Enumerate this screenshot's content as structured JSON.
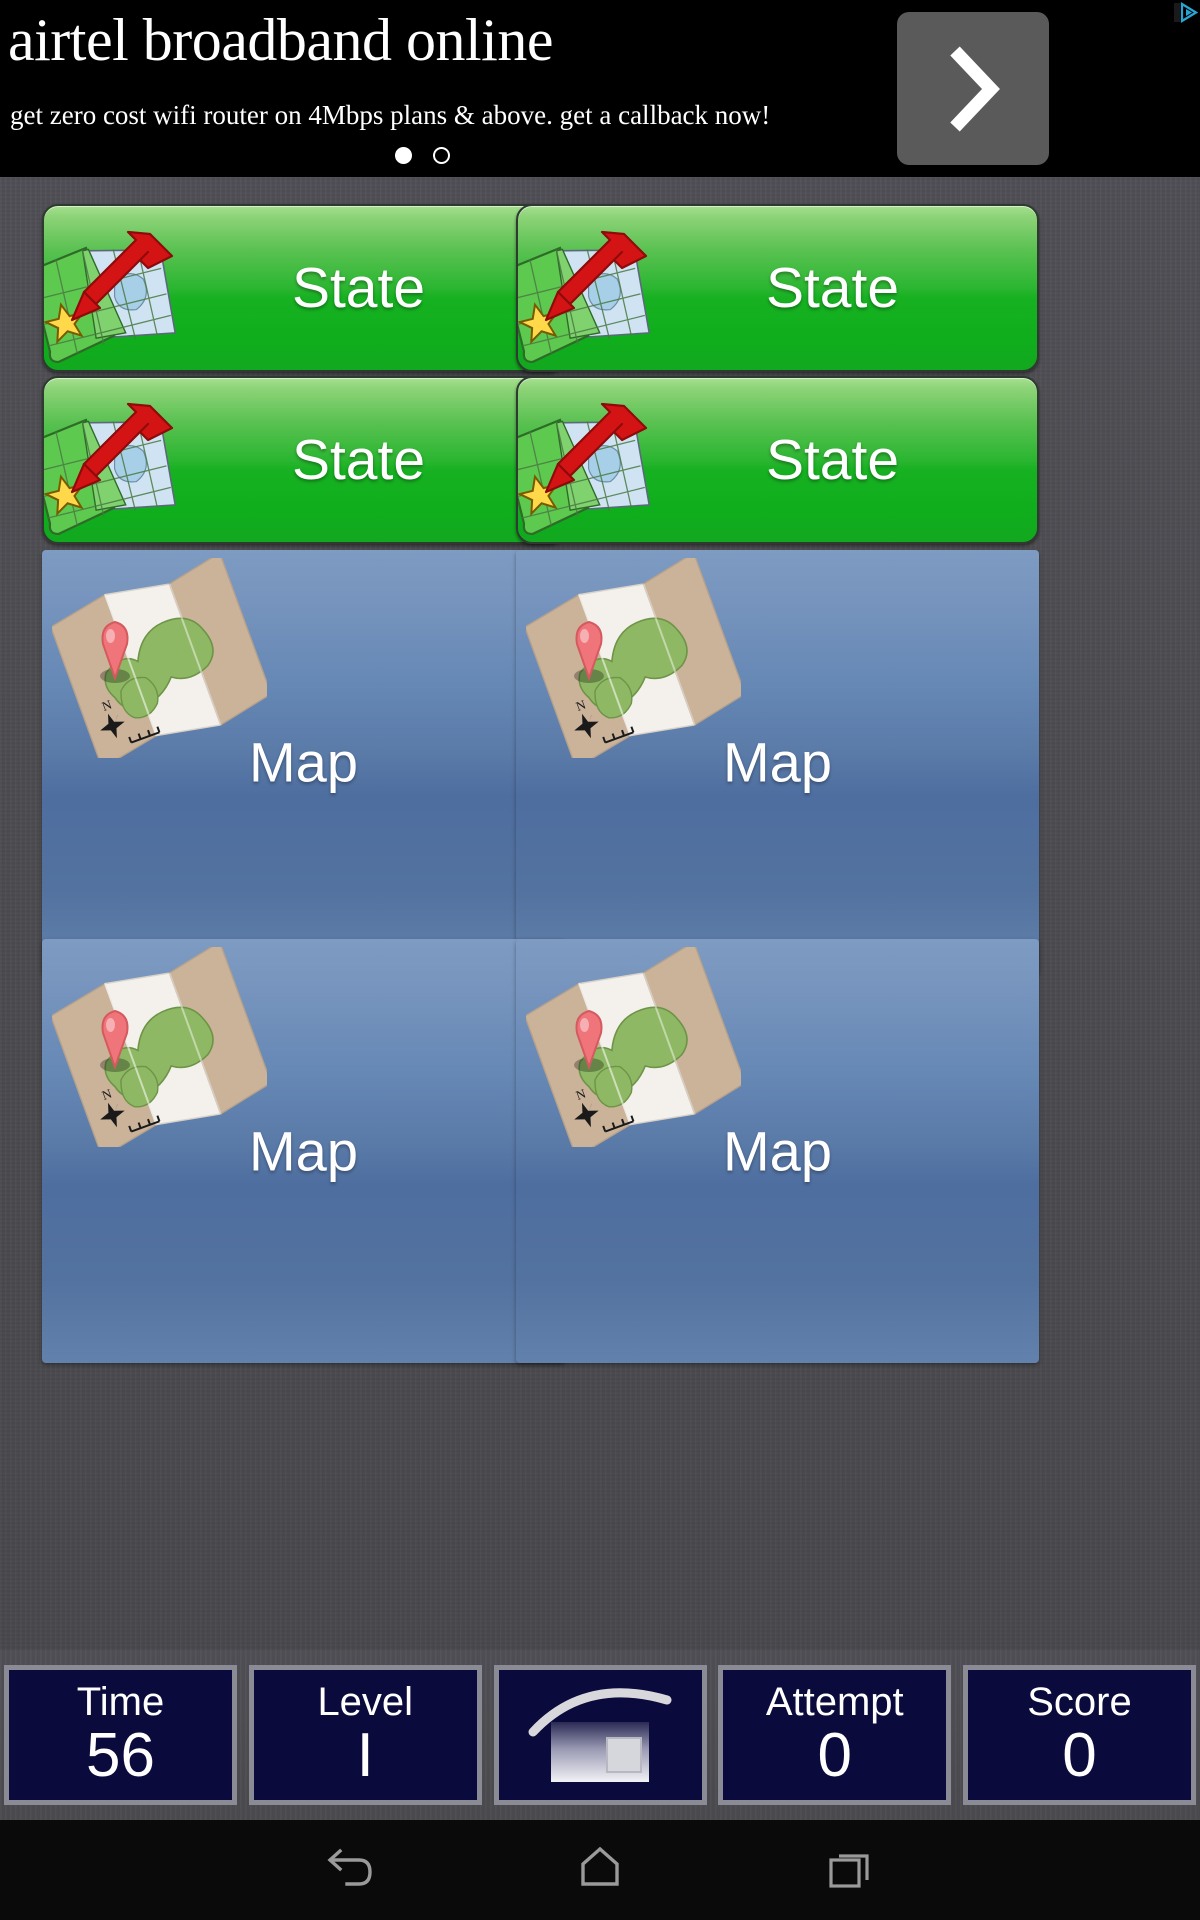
{
  "ad": {
    "title": "airtel broadband online",
    "subtitle": "get zero cost wifi router on 4Mbps plans & above. get a callback now!",
    "next_label": ">",
    "dots": [
      "filled",
      "hollow"
    ],
    "adchoices_icon": "adchoices-icon",
    "bg_color": "#000000",
    "next_btn_color": "#5a5a5a",
    "adchoices_color": "#29a5d4"
  },
  "board": {
    "bg_color": "#4d4d52",
    "state_buttons": [
      {
        "label": "State",
        "icon": "state-map-star-arrow-icon"
      },
      {
        "label": "State",
        "icon": "state-map-star-arrow-icon"
      },
      {
        "label": "State",
        "icon": "state-map-star-arrow-icon"
      },
      {
        "label": "State",
        "icon": "state-map-star-arrow-icon"
      }
    ],
    "map_tiles": [
      {
        "label": "Map",
        "icon": "folded-map-pin-compass-icon"
      },
      {
        "label": "Map",
        "icon": "folded-map-pin-compass-icon"
      },
      {
        "label": "Map",
        "icon": "folded-map-pin-compass-icon"
      },
      {
        "label": "Map",
        "icon": "folded-map-pin-compass-icon"
      }
    ],
    "state_color": "#16b121",
    "map_color": "#5a7aa8"
  },
  "hud": {
    "panels": [
      {
        "label": "Time",
        "value": "56"
      },
      {
        "label": "Level",
        "value": "I"
      },
      {
        "label": "Attempt",
        "value": "0"
      },
      {
        "label": "Score",
        "value": "0"
      }
    ],
    "home_icon": "house-icon",
    "panel_bg": "#0a0a3c",
    "panel_border": "#8b8b95"
  },
  "android_nav": {
    "back_icon": "back-arrow-icon",
    "home_icon": "home-pentagon-icon",
    "recents_icon": "recent-apps-icon",
    "bg_color": "#0a0a0a"
  }
}
